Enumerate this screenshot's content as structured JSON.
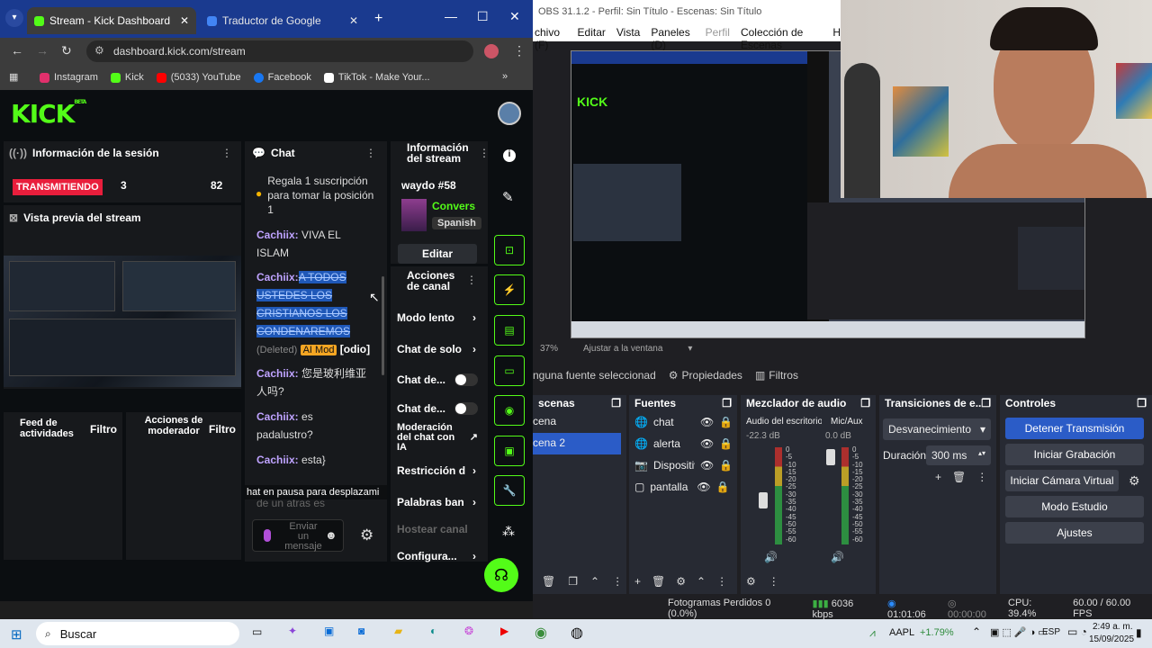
{
  "browser": {
    "tabs": [
      {
        "label": "Stream - Kick Dashboard"
      },
      {
        "label": "Traductor de Google"
      }
    ],
    "url": "dashboard.kick.com/stream",
    "bookmarks": [
      {
        "label": "Instagram",
        "color": "#e1306c"
      },
      {
        "label": "Kick",
        "color": "#53fc18"
      },
      {
        "label": "(5033) YouTube",
        "color": "#ff0000"
      },
      {
        "label": "Facebook",
        "color": "#1877f2"
      },
      {
        "label": "TikTok - Make Your...",
        "color": "#ffffff"
      }
    ]
  },
  "kick": {
    "logo": "KICK",
    "logo_sup": "BETA",
    "session": {
      "title": "Información de la sesión",
      "status": "TRANSMITIENDO",
      "viewers": "3",
      "followers": "82"
    },
    "preview_title": "Vista previa del stream",
    "feed": {
      "title": "Feed de actividades",
      "filter": "Filtro"
    },
    "mod_actions": {
      "title": "Acciones de moderador",
      "filter": "Filtro"
    },
    "chat": {
      "title": "Chat",
      "gift": "Regala 1 suscripción para tomar la posición 1",
      "messages": [
        {
          "user": "Cachiix:",
          "text": "VIVA EL ISLAM"
        },
        {
          "user": "Cachiix:",
          "text": "A TODOS USTEDES LOS CRISTIANOS LOS CONDENAREMOS",
          "deleted": "(Deleted)",
          "badge": "AI Mod",
          "tag": "[odio]"
        },
        {
          "user": "Cachiix:",
          "text": "您是玻利维亚人吗?"
        },
        {
          "user": "Cachiix:",
          "text": "es padalustro?"
        },
        {
          "user": "Cachiix:",
          "text": "esta}"
        }
      ],
      "paused": "hat en pausa para desplazami",
      "paused_under": "de un atras es",
      "input_placeholder": "Enviar un mensaje"
    },
    "stream_info": {
      "title": "Información del stream",
      "stream_name": "waydo #58",
      "category": "Convers",
      "language": "Spanish",
      "edit": "Editar"
    },
    "channel_actions": {
      "title": "Acciones de canal",
      "items": [
        "Modo lento",
        "Chat de solo",
        "Chat de...",
        "Chat de...",
        "Moderación del chat con IA",
        "Restricción d",
        "Palabras ban",
        "Hostear canal",
        "Configura..."
      ]
    }
  },
  "obs": {
    "title": "OBS 31.1.2 - Perfil: Sin Título - Escenas: Sin Título",
    "menu": [
      "chivo (F)",
      "Editar",
      "Vista",
      "Paneles (D)",
      "Perfil",
      "Colección de Escenas",
      "H"
    ],
    "zoom": "37%",
    "fit": "Ajustar a la ventana",
    "no_source": "nguna fuente seleccionad",
    "properties": "Propiedades",
    "filters": "Filtros",
    "scenes": {
      "title": "scenas",
      "items": [
        "cena",
        "cena 2"
      ]
    },
    "sources": {
      "title": "Fuentes",
      "items": [
        "chat",
        "alerta",
        "Dispositiv",
        "pantalla"
      ]
    },
    "mixer": {
      "title": "Mezclador de audio",
      "channels": [
        {
          "name": "Audio del escritorio",
          "db": "-22.3 dB"
        },
        {
          "name": "Mic/Aux",
          "db": "0.0 dB"
        }
      ],
      "ticks": [
        "0",
        "-5",
        "-10",
        "-15",
        "-20",
        "-25",
        "-30",
        "-35",
        "-40",
        "-45",
        "-50",
        "-55",
        "-60"
      ]
    },
    "transitions": {
      "title": "Transiciones de e...",
      "type": "Desvanecimiento",
      "duration_label": "Duración",
      "duration": "300 ms"
    },
    "controls": {
      "title": "Controles",
      "buttons": [
        "Detener Transmisión",
        "Iniciar Grabación",
        "Iniciar Cámara Virtual",
        "Modo Estudio",
        "Ajustes"
      ]
    },
    "status": {
      "dropped": "Fotogramas Perdidos 0 (0.0%)",
      "bitrate": "6036 kbps",
      "live_time": "01:01:06",
      "rec_time": "00:00:00",
      "cpu": "CPU: 39.4%",
      "fps": "60.00 / 60.00 FPS"
    }
  },
  "taskbar": {
    "search": "Buscar",
    "stock": "AAPL",
    "stock_change": "+1.79%",
    "lang": "ESP",
    "time": "2:49 a. m.",
    "date": "15/09/2025"
  }
}
